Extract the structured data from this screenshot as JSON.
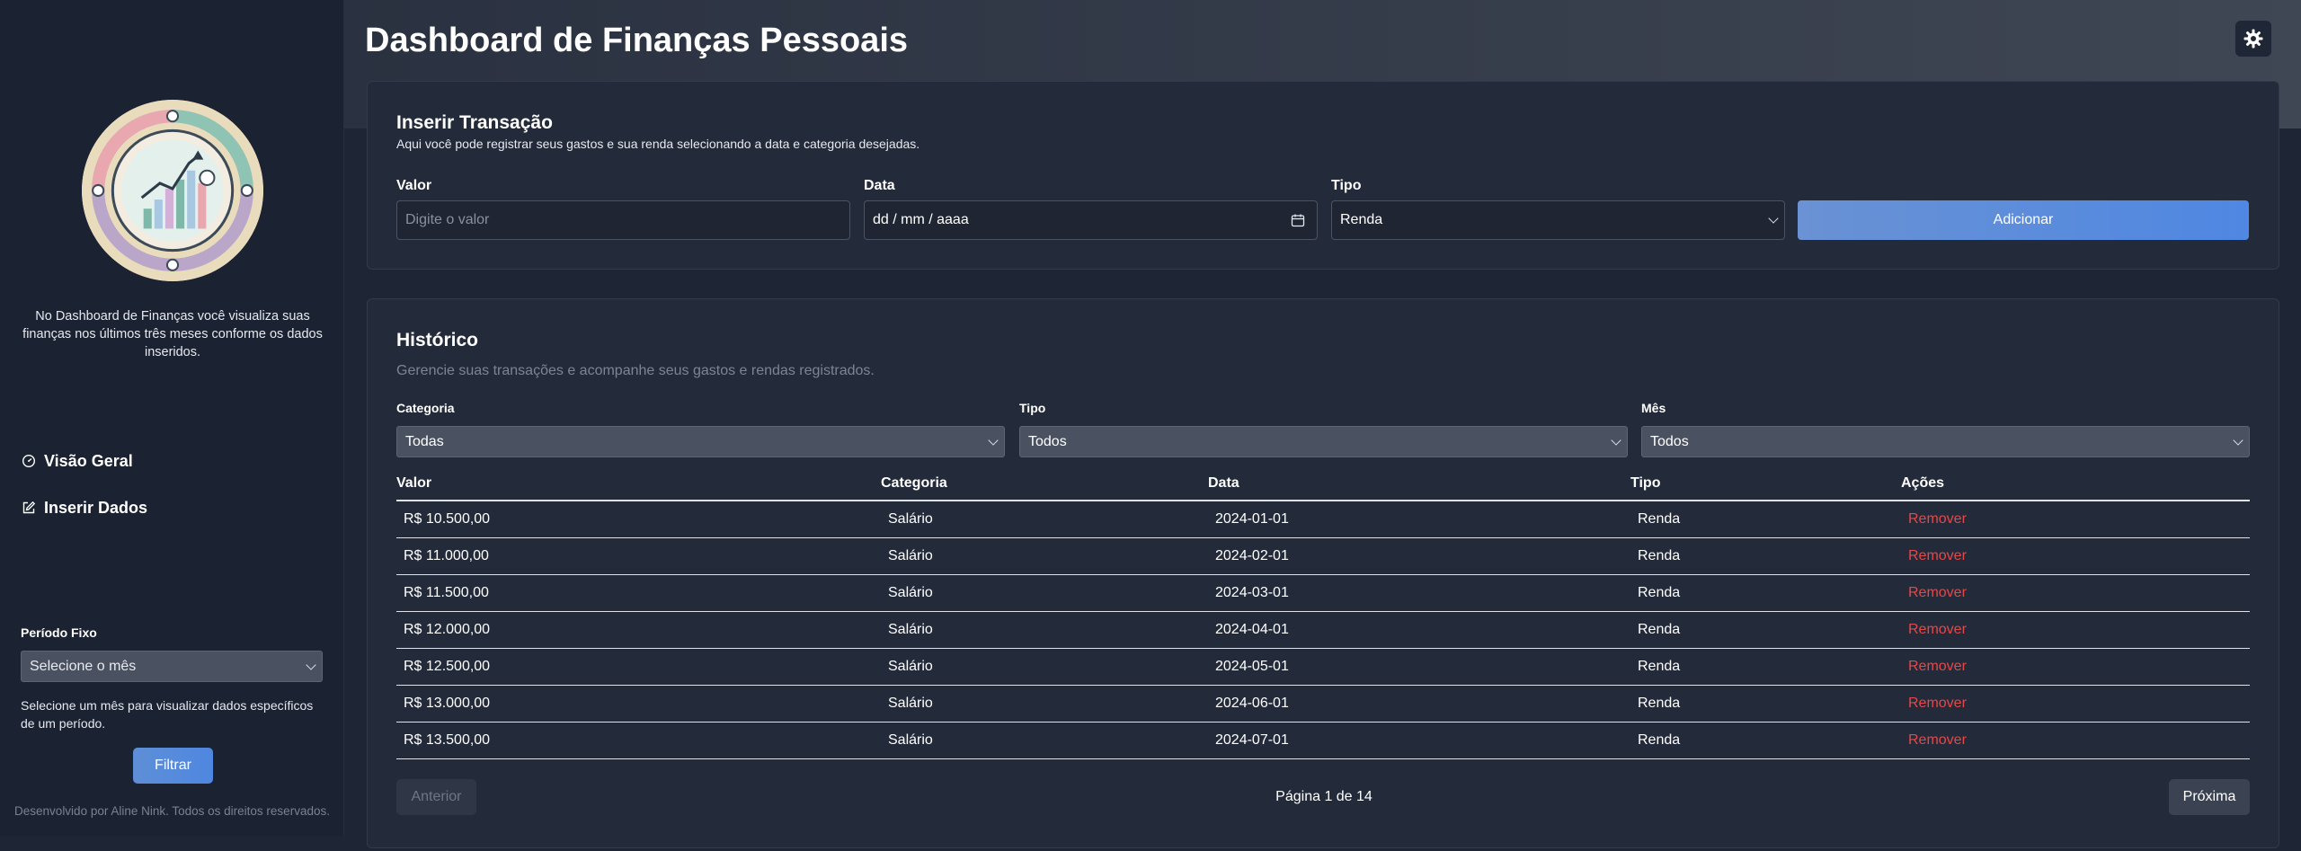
{
  "header": {
    "title": "Dashboard de Finanças Pessoais",
    "theme_icon": "gear-icon"
  },
  "sidebar": {
    "description": "No Dashboard de Finanças você visualiza suas finanças nos últimos três meses conforme os dados inseridos.",
    "nav": [
      {
        "label": "Visão Geral",
        "icon": "dashboard-gauge-icon"
      },
      {
        "label": "Inserir Dados",
        "icon": "edit-icon"
      }
    ],
    "period_label": "Período Fixo",
    "period_select": "Selecione o mês",
    "period_help": "Selecione um mês para visualizar dados específicos de um período.",
    "filter_button": "Filtrar",
    "footer": "Desenvolvido por Aline Nink. Todos os direitos reservados."
  },
  "insert": {
    "title": "Inserir Transação",
    "subtitle": "Aqui você pode registrar seus gastos e sua renda selecionando a data e categoria desejadas.",
    "valor_label": "Valor",
    "valor_placeholder": "Digite o valor",
    "data_label": "Data",
    "data_placeholder": "dd / mm / aaaa",
    "tipo_label": "Tipo",
    "tipo_value": "Renda",
    "add_button": "Adicionar"
  },
  "history": {
    "title": "Histórico",
    "subtitle": "Gerencie suas transações e acompanhe seus gastos e rendas registrados.",
    "filters": [
      {
        "label": "Categoria",
        "value": "Todas"
      },
      {
        "label": "Tipo",
        "value": "Todos"
      },
      {
        "label": "Mês",
        "value": "Todos"
      }
    ],
    "columns": [
      "Valor",
      "Categoria",
      "Data",
      "Tipo",
      "Ações"
    ],
    "rows": [
      {
        "valor": "R$ 10.500,00",
        "categoria": "Salário",
        "data": "2024-01-01",
        "tipo": "Renda",
        "acao": "Remover"
      },
      {
        "valor": "R$ 11.000,00",
        "categoria": "Salário",
        "data": "2024-02-01",
        "tipo": "Renda",
        "acao": "Remover"
      },
      {
        "valor": "R$ 11.500,00",
        "categoria": "Salário",
        "data": "2024-03-01",
        "tipo": "Renda",
        "acao": "Remover"
      },
      {
        "valor": "R$ 12.000,00",
        "categoria": "Salário",
        "data": "2024-04-01",
        "tipo": "Renda",
        "acao": "Remover"
      },
      {
        "valor": "R$ 12.500,00",
        "categoria": "Salário",
        "data": "2024-05-01",
        "tipo": "Renda",
        "acao": "Remover"
      },
      {
        "valor": "R$ 13.000,00",
        "categoria": "Salário",
        "data": "2024-06-01",
        "tipo": "Renda",
        "acao": "Remover"
      },
      {
        "valor": "R$ 13.500,00",
        "categoria": "Salário",
        "data": "2024-07-01",
        "tipo": "Renda",
        "acao": "Remover"
      }
    ],
    "prev_button": "Anterior",
    "page_text": "Página 1 de 14",
    "next_button": "Próxima"
  },
  "colors": {
    "accent": "#4f87e0",
    "remove": "#e24a4a",
    "background": "#1e2535",
    "card": "#232a3a"
  }
}
